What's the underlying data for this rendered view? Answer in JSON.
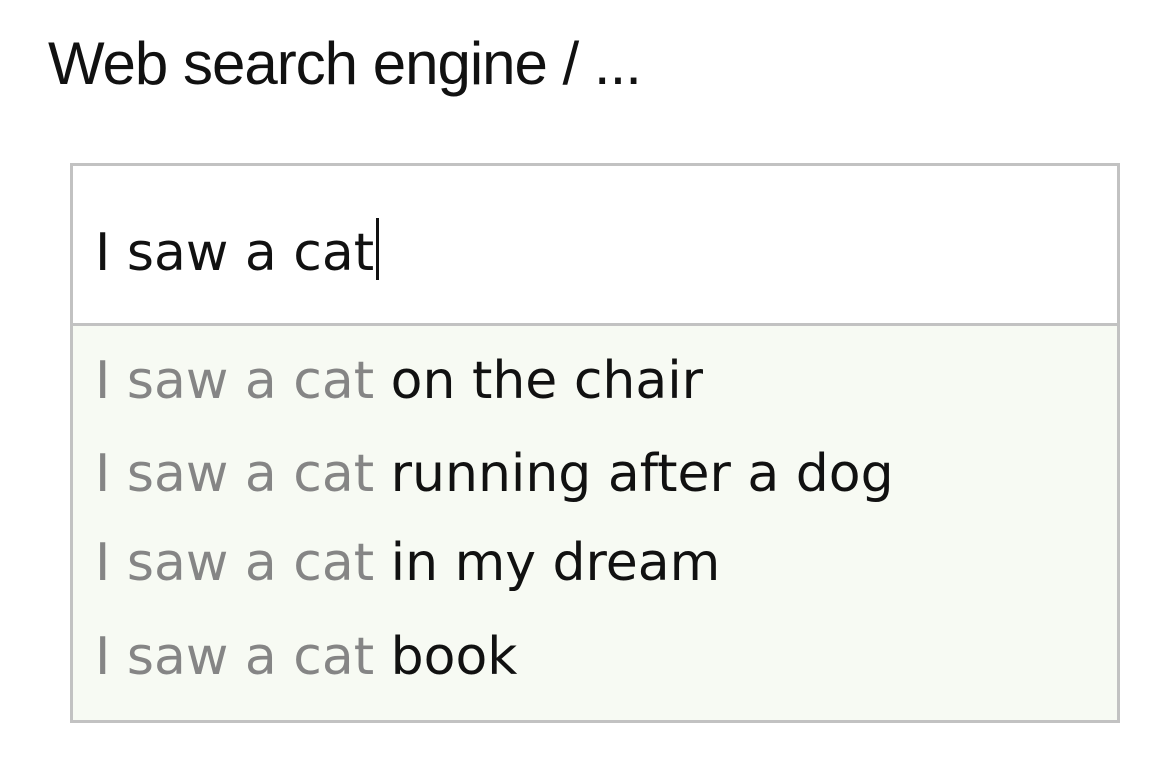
{
  "header": {
    "title": "Web search engine / ..."
  },
  "search": {
    "value": "I saw a cat"
  },
  "suggestions": [
    {
      "prefix": "I saw a cat",
      "completion": "on the chair"
    },
    {
      "prefix": "I saw a cat",
      "completion": "running after a dog"
    },
    {
      "prefix": "I saw a cat",
      "completion": "in my dream"
    },
    {
      "prefix": "I saw a cat",
      "completion": "book"
    }
  ],
  "colors": {
    "text": "#111111",
    "prefix_gray": "#858585",
    "border": "#c2c2c2",
    "suggestions_background": "#f7faf3"
  }
}
